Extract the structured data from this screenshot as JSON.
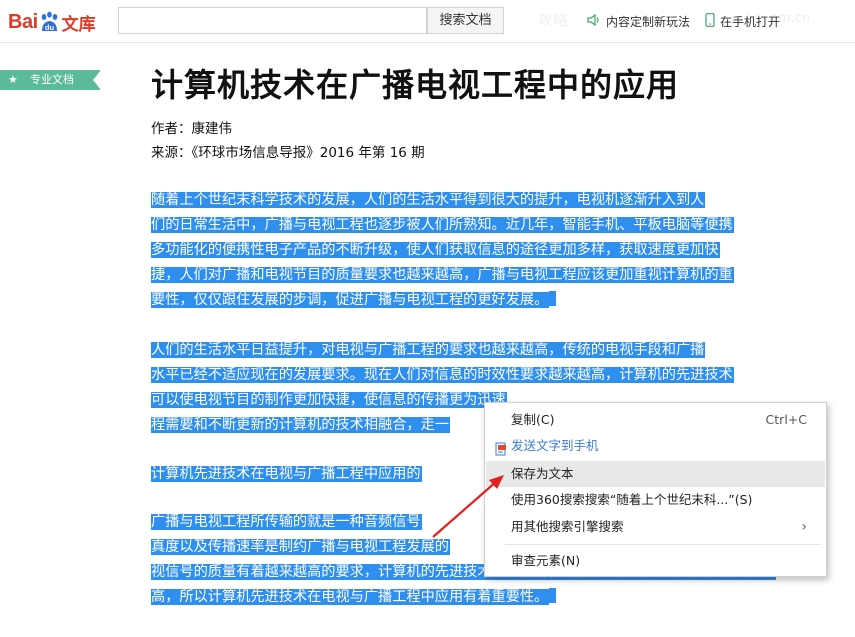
{
  "header": {
    "logo_bai": "Bai",
    "logo_du": "du",
    "logo_wenku": "文库",
    "search_placeholder": "",
    "search_button": "搜索文档",
    "watermark": "攻略",
    "watermark2": "am.cn",
    "link_custom": "内容定制新玩法",
    "link_mobile": "在手机打开"
  },
  "side_tag": {
    "label": "专业文档"
  },
  "doc": {
    "title": "计算机技术在广播电视工程中的应用",
    "author": "作者：康建伟",
    "source": "来源：《环球市场信息导报》2016 年第 16 期",
    "paragraphs": [
      [
        "        随着上个世纪末科学技术的发展，人们的生活水平得到很大的提升，电视机逐渐升入到人",
        "们的日常生活中，广播与电视工程也逐步被人们所熟知。近几年，智能手机、平板电脑等便携",
        "多功能化的便携性电子产品的不断升级，使人们获取信息的途径更加多样，获取速度更加快",
        "捷，人们对广播和电视节目的质量要求也越来越高，广播与电视工程应该更加重视计算机的重",
        "要性，仅仅跟住发展的步调，促进广播与电视工程的更好发展。"
      ],
      [
        "        人们的生活水平日益提升，对电视与广播工程的要求也越来越高，传统的电视手段和广播",
        "水平已经不适应现在的发展要求。现在人们对信息的时效性要求越来越高，计算机的先进技术",
        "可以使电视节目的制作更加快捷，使信息的传播更为迅速",
        "程需要和不断更新的计算机的技术相融合，走一"
      ],
      [
        "        计算机先进技术在电视与广播工程中应用的"
      ],
      [
        "        广播与电视工程所传输的就是一种音频信号",
        "真度以及传播速率是制约广播与电视工程发展的",
        "视信号的质量有着越来越高的要求，计算机的先进技术可以使音视频信号的传播速度更快，保真度更",
        "高，所以计算机先进技术在电视与广播工程中应用有着重要性。"
      ]
    ]
  },
  "context_menu": {
    "items": [
      {
        "label": "复制(C)",
        "shortcut": "Ctrl+C"
      },
      {
        "label": "发送文字到手机"
      },
      {
        "label": "保存为文本"
      },
      {
        "label": "使用360搜索搜索“随着上个世纪末科...”(S)"
      },
      {
        "label": "用其他搜索引擎搜索"
      },
      {
        "label": "审查元素(N)"
      }
    ]
  },
  "colors": {
    "brand_red": "#de3a24",
    "brand_blue": "#2f6fd8",
    "selection": "#2f8fef",
    "tag_green": "#5aba99",
    "arrow_red": "#e02020"
  }
}
